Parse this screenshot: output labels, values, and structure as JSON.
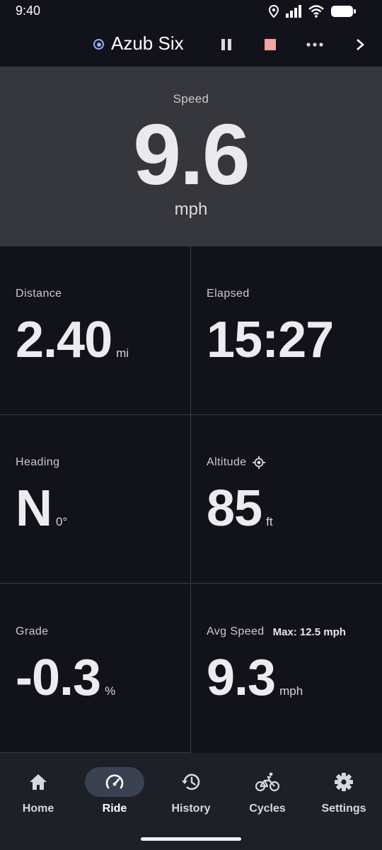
{
  "status_bar": {
    "time": "9:40"
  },
  "top_bar": {
    "device_name": "Azub Six",
    "accent": "#8fb2ff",
    "stop_color": "#f5a3a3"
  },
  "speed": {
    "label": "Speed",
    "value": "9.6",
    "unit": "mph"
  },
  "metrics": {
    "distance": {
      "label": "Distance",
      "value": "2.40",
      "unit": "mi"
    },
    "elapsed": {
      "label": "Elapsed",
      "value": "15:27",
      "unit": ""
    },
    "heading": {
      "label": "Heading",
      "value": "N",
      "unit": "0°"
    },
    "altitude": {
      "label": "Altitude",
      "value": "85",
      "unit": "ft",
      "icon": "gps-fixed-icon"
    },
    "grade": {
      "label": "Grade",
      "value": "-0.3",
      "unit": "%"
    },
    "avg_speed": {
      "label": "Avg Speed",
      "max": "Max: 12.5 mph",
      "value": "9.3",
      "unit": "mph"
    }
  },
  "nav": {
    "active": "Ride",
    "items": [
      {
        "label": "Home",
        "icon": "home-icon"
      },
      {
        "label": "Ride",
        "icon": "speedometer-icon"
      },
      {
        "label": "History",
        "icon": "history-icon"
      },
      {
        "label": "Cycles",
        "icon": "bicycle-icon"
      },
      {
        "label": "Settings",
        "icon": "gear-icon"
      }
    ]
  }
}
